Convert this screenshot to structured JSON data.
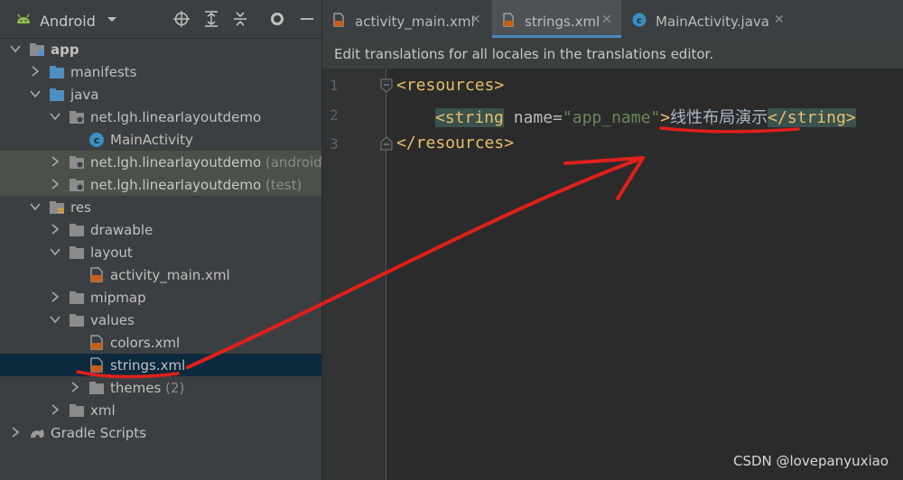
{
  "project_panel": {
    "view_title": "Android",
    "tree": [
      {
        "label": "app",
        "suffix": ""
      },
      {
        "label": "manifests",
        "suffix": ""
      },
      {
        "label": "java",
        "suffix": ""
      },
      {
        "label": "net.lgh.linearlayoutdemo",
        "suffix": ""
      },
      {
        "label": "MainActivity",
        "suffix": ""
      },
      {
        "label": "net.lgh.linearlayoutdemo",
        "suffix": " (androidT"
      },
      {
        "label": "net.lgh.linearlayoutdemo",
        "suffix": " (test)"
      },
      {
        "label": "res",
        "suffix": ""
      },
      {
        "label": "drawable",
        "suffix": ""
      },
      {
        "label": "layout",
        "suffix": ""
      },
      {
        "label": "activity_main.xml",
        "suffix": ""
      },
      {
        "label": "mipmap",
        "suffix": ""
      },
      {
        "label": "values",
        "suffix": ""
      },
      {
        "label": "colors.xml",
        "suffix": ""
      },
      {
        "label": "strings.xml",
        "suffix": ""
      },
      {
        "label": "themes",
        "suffix": " (2)"
      },
      {
        "label": "xml",
        "suffix": ""
      },
      {
        "label": "Gradle Scripts",
        "suffix": ""
      }
    ]
  },
  "editor": {
    "tabs": [
      {
        "label": "activity_main.xml"
      },
      {
        "label": "strings.xml"
      },
      {
        "label": "MainActivity.java"
      }
    ],
    "notification": "Edit translations for all locales in the translations editor.",
    "line_numbers": [
      "1",
      "2",
      "3"
    ],
    "code": {
      "l1_tag": "<resources>",
      "l2_open": "<string",
      "l2_attr": " name=",
      "l2_val": "\"app_name\"",
      "l2_gt": ">",
      "l2_text": "线性布局演示",
      "l2_close": "</string>",
      "l3_tag": "</resources>"
    }
  },
  "watermark": "CSDN @lovepanyuxiao",
  "colors": {
    "annotation": "#e0201c",
    "selection": "#0d293e",
    "accent": "#4a88c7"
  }
}
